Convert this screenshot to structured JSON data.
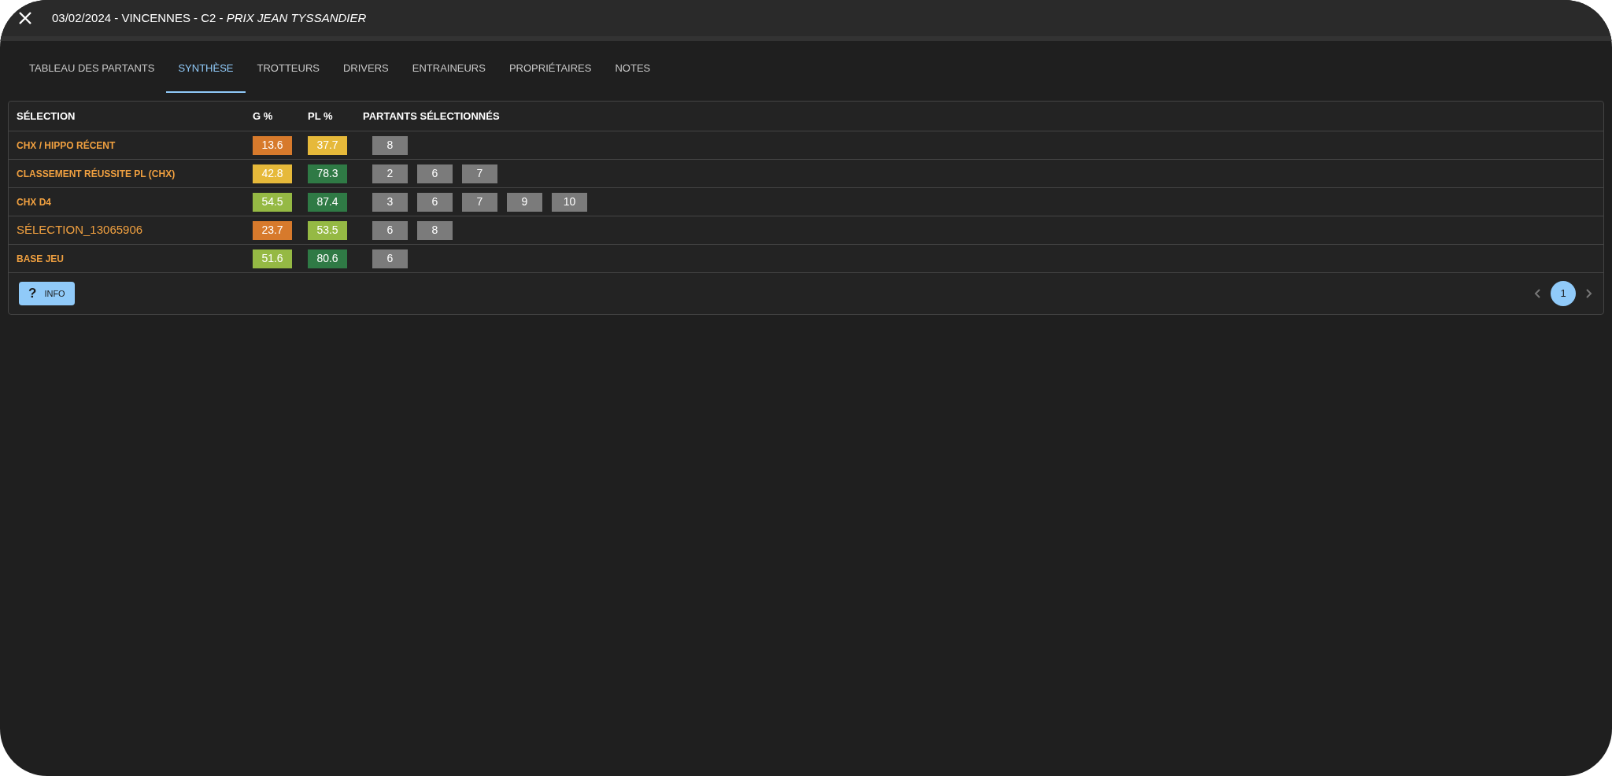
{
  "window": {
    "title": "03/02/2024 - VINCENNES - C2 - ",
    "race_name": "PRIX JEAN TYSSANDIER"
  },
  "tabs": [
    {
      "label": "TABLEAU DES PARTANTS",
      "selected": false
    },
    {
      "label": "SYNTHÈSE",
      "selected": true
    },
    {
      "label": "TROTTEURS",
      "selected": false
    },
    {
      "label": "DRIVERS",
      "selected": false
    },
    {
      "label": "ENTRAINEURS",
      "selected": false
    },
    {
      "label": "PROPRIÉTAIRES",
      "selected": false
    },
    {
      "label": "NOTES",
      "selected": false
    }
  ],
  "table": {
    "columns": [
      "SÉLECTION",
      "G %",
      "PL %",
      "PARTANTS SÉLECTIONNÉS"
    ],
    "rows": [
      {
        "selection": "CHX / HIPPO RÉCENT",
        "kind": "preset",
        "g": {
          "value": "13.6",
          "color": "#d77a2c"
        },
        "pl": {
          "value": "37.7",
          "color": "#e6b93a"
        },
        "partants": [
          "8"
        ]
      },
      {
        "selection": "CLASSEMENT RÉUSSITE PL (CHX)",
        "kind": "preset",
        "g": {
          "value": "42.8",
          "color": "#e6b93a"
        },
        "pl": {
          "value": "78.3",
          "color": "#2f7a45"
        },
        "partants": [
          "2",
          "6",
          "7"
        ]
      },
      {
        "selection": "CHX D4",
        "kind": "preset",
        "g": {
          "value": "54.5",
          "color": "#95b944"
        },
        "pl": {
          "value": "87.4",
          "color": "#2f7a45"
        },
        "partants": [
          "3",
          "6",
          "7",
          "9",
          "10"
        ]
      },
      {
        "selection": "SÉLECTION_13065906",
        "kind": "custom",
        "g": {
          "value": "23.7",
          "color": "#d77a2c"
        },
        "pl": {
          "value": "53.5",
          "color": "#95b944"
        },
        "partants": [
          "6",
          "8"
        ]
      },
      {
        "selection": "BASE JEU",
        "kind": "preset",
        "g": {
          "value": "51.6",
          "color": "#95b944"
        },
        "pl": {
          "value": "80.6",
          "color": "#2f7a45"
        },
        "partants": [
          "6"
        ]
      }
    ]
  },
  "info_button": {
    "icon_text": "?",
    "label": "INFO"
  },
  "pagination": {
    "pages": [
      {
        "label": "1",
        "selected": true
      }
    ]
  }
}
